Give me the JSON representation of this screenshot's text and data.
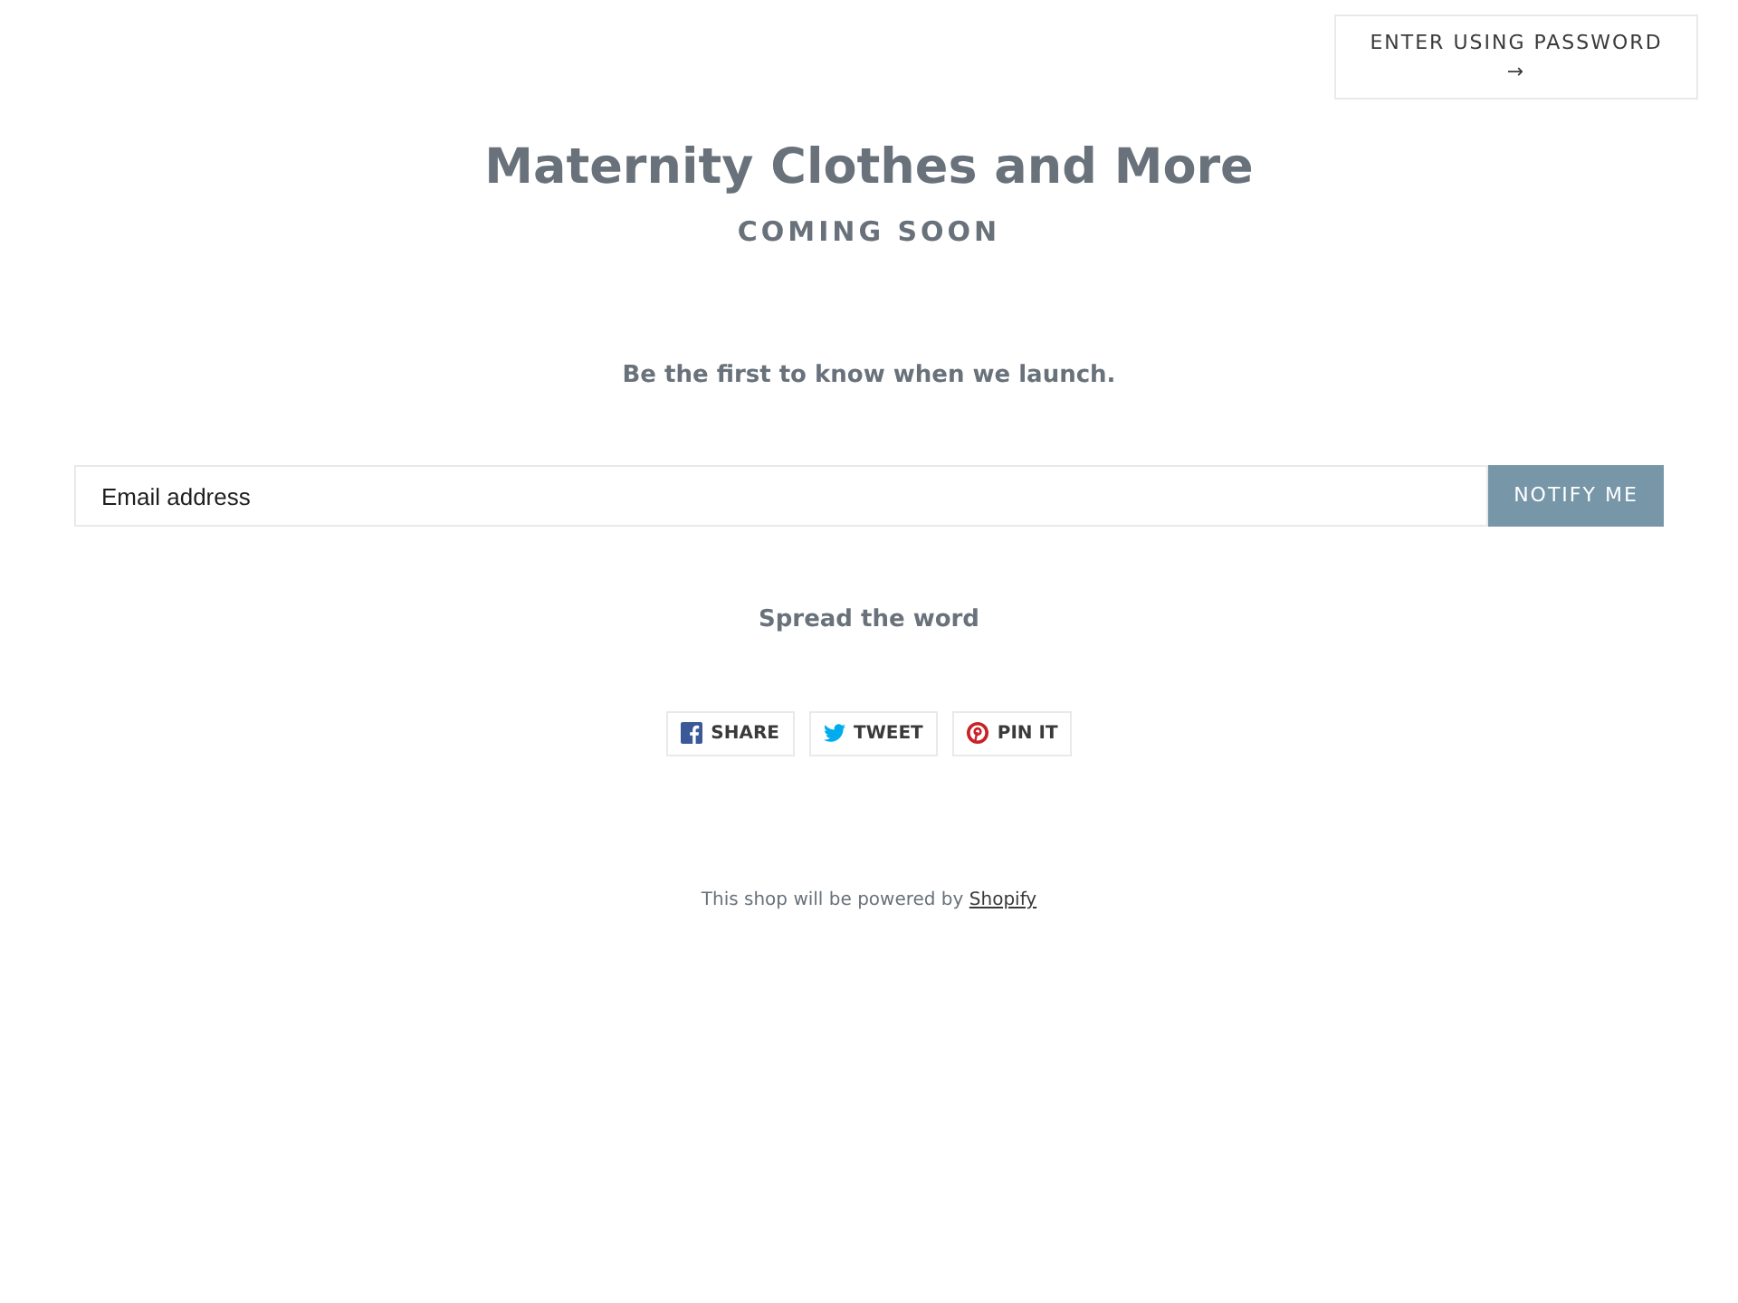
{
  "header": {
    "password_button": "ENTER USING PASSWORD",
    "password_arrow": "→"
  },
  "title": "Maternity Clothes and More",
  "subtitle": "COMING SOON",
  "intro": "Be the first to know when we launch.",
  "signup": {
    "placeholder": "Email address",
    "button": "NOTIFY ME"
  },
  "share": {
    "heading": "Spread the word",
    "buttons": [
      {
        "kind": "facebook",
        "label": "SHARE"
      },
      {
        "kind": "twitter",
        "label": "TWEET"
      },
      {
        "kind": "pinterest",
        "label": "PIN IT"
      }
    ]
  },
  "footer": {
    "text": "This shop will be powered by",
    "link": "Shopify"
  }
}
